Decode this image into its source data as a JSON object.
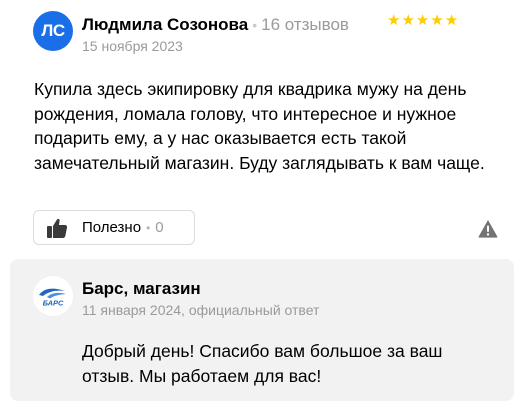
{
  "review": {
    "avatar_initials": "ЛС",
    "avatar_color": "#1a6fe8",
    "author_name": "Людмила Созонова",
    "separator": "•",
    "review_count": "16 отзывов",
    "rating": 5,
    "star_glyph": "★",
    "star_color": "#ffcc00",
    "date": "15 ноября 2023",
    "text": "Купила здесь экипировку для квадрика мужу на день рождения, ломала голову, что интересное и нужное подарить ему, а у нас оказывается есть такой замечательный магазин. Буду заглядывать к вам чаще.",
    "useful_label": "Полезно",
    "useful_separator": "•",
    "useful_count": "0",
    "useful_icon": "thumbs-up-icon",
    "report_icon": "warning-icon"
  },
  "reply": {
    "shop_name": "Барс, магазин",
    "logo_text": "БАРС",
    "meta": "11 января 2024, официальный ответ",
    "text": "Добрый день! Спасибо вам большое за ваш отзыв. Мы работаем для вас!",
    "background": "#f2f2f2"
  }
}
